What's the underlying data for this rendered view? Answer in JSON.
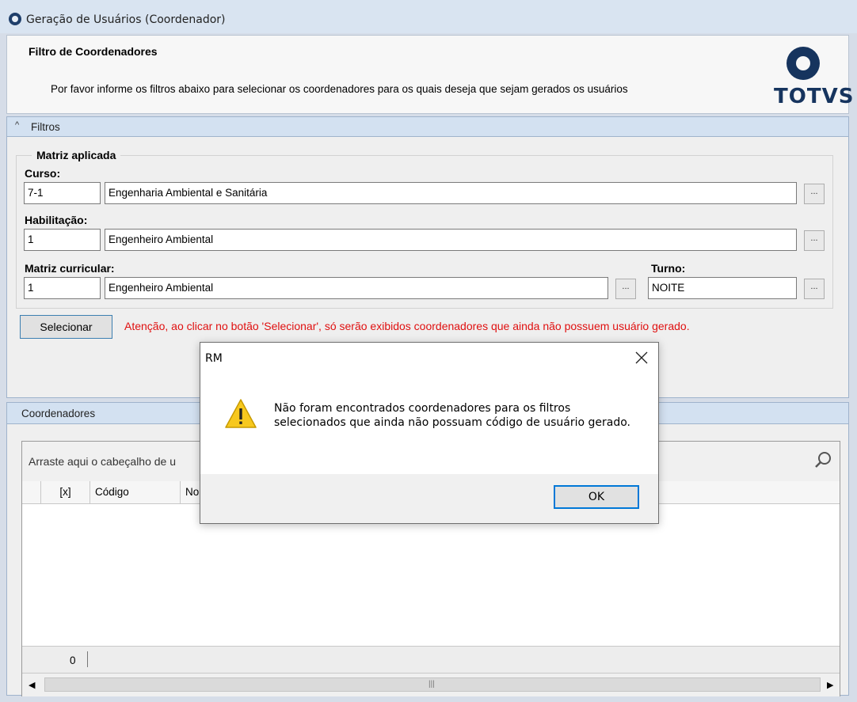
{
  "window": {
    "title": "Geração de Usuários (Coordenador)"
  },
  "header": {
    "title": "Filtro de Coordenadores",
    "description": "Por favor informe os filtros abaixo para selecionar os coordenadores para os quais deseja que sejam gerados os usuários",
    "logo_text": "TOTVS"
  },
  "filtros": {
    "section_label": "Filtros",
    "group_title": "Matriz aplicada",
    "curso": {
      "label": "Curso:",
      "code": "7-1",
      "name": "Engenharia Ambiental e Sanitária"
    },
    "habilitacao": {
      "label": "Habilitação:",
      "code": "1",
      "name": "Engenheiro Ambiental"
    },
    "matriz": {
      "label": "Matriz curricular:",
      "code": "1",
      "name": "Engenheiro Ambiental"
    },
    "turno": {
      "label": "Turno:",
      "value": "NOITE"
    },
    "lookup_label": "...",
    "select_button": "Selecionar",
    "warning": "Atenção, ao clicar no botão 'Selecionar', só serão exibidos coordenadores que ainda não possuem usuário gerado."
  },
  "coordenadores": {
    "section_label": "Coordenadores",
    "group_area_text": "Arraste aqui o cabeçalho de u",
    "columns": [
      "[x]",
      "Código",
      "No"
    ],
    "count": "0"
  },
  "dialog": {
    "title": "RM",
    "message": "Não foram encontrados coordenadores para os filtros selecionados que ainda não possuam código de usuário gerado.",
    "ok_label": "OK"
  },
  "colors": {
    "warning_text": "#e01010",
    "section_bar": "#d3e1f1",
    "logo": "#16345e",
    "dialog_focus": "#0078d7"
  }
}
